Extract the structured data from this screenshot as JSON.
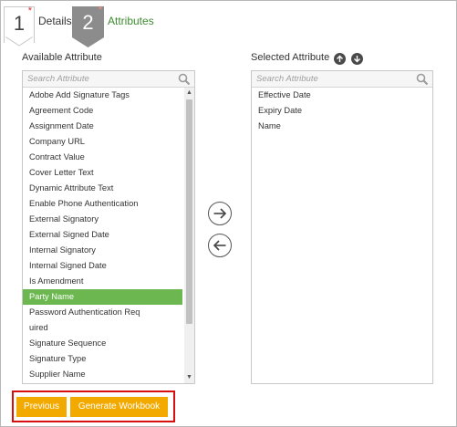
{
  "wizard": {
    "step1": {
      "number": "1",
      "required_mark": "*",
      "label": "Details"
    },
    "step2": {
      "number": "2",
      "required_mark": "*",
      "label": "Attributes"
    }
  },
  "available": {
    "title": "Available Attribute",
    "search_placeholder": "Search Attribute",
    "items": [
      "Adobe Add Signature Tags",
      "Agreement Code",
      "Assignment Date",
      "Company URL",
      "Contract Value",
      "Cover Letter Text",
      "Dynamic Attribute Text",
      "Enable Phone Authentication",
      "External Signatory",
      "External Signed Date",
      "Internal Signatory",
      "Internal Signed Date",
      "Is Amendment",
      "Party Name",
      "Password Authentication Req",
      "uired",
      "Signature Sequence",
      "Signature Type",
      "Supplier Name"
    ],
    "selected_item": "Party Name"
  },
  "selected": {
    "title": "Selected Attribute",
    "search_placeholder": "Search Attribute",
    "items": [
      "Effective Date",
      "Expiry Date",
      "Name"
    ]
  },
  "footer": {
    "previous_label": "Previous",
    "generate_label": "Generate Workbook"
  },
  "colors": {
    "accent_button": "#f2a900",
    "selected_row": "#6cb750",
    "step_active": "#8c8c8c",
    "step_label_active": "#3d8b2f",
    "highlight_box": "#d80f0f"
  }
}
